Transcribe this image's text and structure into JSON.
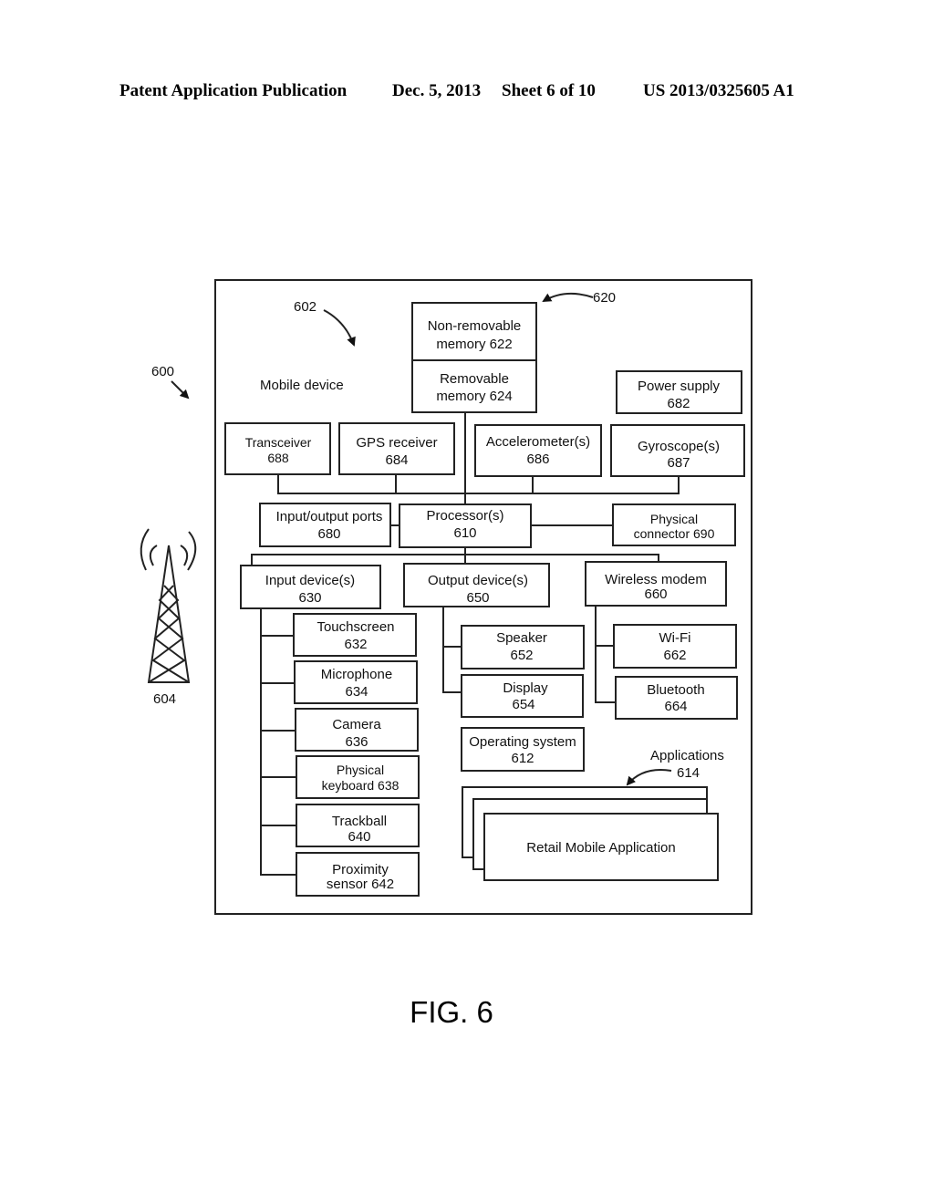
{
  "header": {
    "publication": "Patent Application Publication",
    "date": "Dec. 5, 2013",
    "sheet": "Sheet 6 of 10",
    "number": "US 2013/0325605 A1"
  },
  "labels": {
    "system_ref": "600",
    "device_ref": "602",
    "tower_ref": "604",
    "memory_group_ref": "620",
    "device_name": "Mobile  device",
    "applications": [
      "Applications",
      "614"
    ],
    "figure": "FIG. 6"
  },
  "boxes": {
    "non_removable_memory": [
      "Non-removable",
      "memory 622"
    ],
    "removable_memory": [
      "Removable",
      "memory 624"
    ],
    "power_supply": [
      "Power supply",
      "682"
    ],
    "transceiver": [
      "Transceiver",
      "688"
    ],
    "gps_receiver": [
      "GPS receiver",
      "684"
    ],
    "accelerometer": [
      "Accelerometer(s)",
      "686"
    ],
    "gyroscope": [
      "Gyroscope(s)",
      "687"
    ],
    "io_ports": [
      "Input/output ports",
      "680"
    ],
    "processor": [
      "Processor(s)",
      "610"
    ],
    "physical_connector": [
      "Physical",
      "connector 690"
    ],
    "input_devices": [
      "Input device(s)",
      "630"
    ],
    "output_devices": [
      "Output device(s)",
      "650"
    ],
    "wireless_modem": [
      "Wireless modem",
      "660"
    ],
    "touchscreen": [
      "Touchscreen",
      "632"
    ],
    "microphone": [
      "Microphone",
      "634"
    ],
    "camera": [
      "Camera",
      "636"
    ],
    "physical_keyboard": [
      "Physical",
      "keyboard 638"
    ],
    "trackball": [
      "Trackball",
      "640"
    ],
    "proximity_sensor": [
      "Proximity",
      "sensor 642"
    ],
    "speaker": [
      "Speaker",
      "652"
    ],
    "display": [
      "Display",
      "654"
    ],
    "wifi": [
      "Wi-Fi",
      "662"
    ],
    "bluetooth": [
      "Bluetooth",
      "664"
    ],
    "operating_system": [
      "Operating system",
      "612"
    ],
    "retail_app": [
      "Retail Mobile Application"
    ]
  }
}
